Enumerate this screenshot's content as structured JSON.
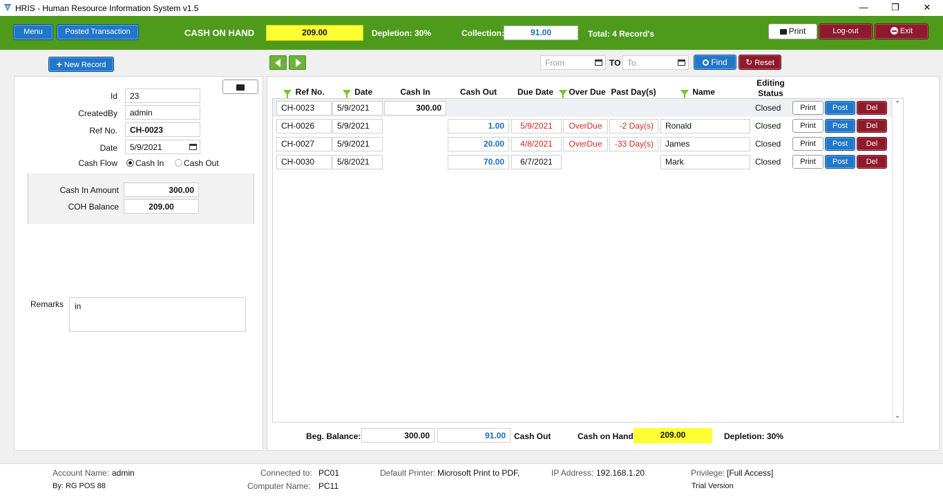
{
  "window": {
    "title": "HRIS - Human Resource Information System v1.5",
    "minimize": "—",
    "maximize": "❐",
    "close": "✕"
  },
  "toolbar": {
    "menu_label": "Menu",
    "posted_label": "Posted Transaction",
    "coh_label": "CASH ON HAND",
    "coh_value": "209.00",
    "depletion_label": "Depletion:",
    "depletion_value": "30%",
    "collection_label": "Collection:",
    "collection_value": "91.00",
    "total_text": "Total: 4 Record's",
    "print_label": "Print",
    "logout_label": "Log-out",
    "exit_label": "Exit"
  },
  "left": {
    "new_record_label": "New Record",
    "fields": {
      "id_label": "Id",
      "id_value": "23",
      "createdby_label": "CreatedBy",
      "createdby_value": "admin",
      "refno_label": "Ref No.",
      "refno_value": "CH-0023",
      "date_label": "Date",
      "date_value": "5/9/2021",
      "cashflow_label": "Cash Flow",
      "cashin_option": "Cash In",
      "cashout_option": "Cash Out",
      "cashflow_selected": "Cash In",
      "cashin_amount_label": "Cash In Amount",
      "cashin_amount_value": "300.00",
      "coh_balance_label": "COH Balance",
      "coh_balance_value": "209.00",
      "remarks_label": "Remarks",
      "remarks_value": "in"
    }
  },
  "filter": {
    "from_placeholder": "From",
    "to_label": "TO",
    "to_placeholder": "To",
    "find_label": "Find",
    "reset_label": "Reset"
  },
  "table": {
    "headers": {
      "refno": "Ref No.",
      "date": "Date",
      "cashin": "Cash In",
      "cashout": "Cash Out",
      "duedate": "Due Date",
      "overdue": "Over Due",
      "pastdays": "Past Day(s)",
      "name": "Name",
      "editing_status": "Editing Status"
    },
    "rows": [
      {
        "refno": "CH-0023",
        "date": "5/9/2021",
        "cashin": "300.00",
        "cashout": "",
        "duedate": "",
        "overdue": "",
        "pastdays": "",
        "name": "",
        "status": "Closed"
      },
      {
        "refno": "CH-0026",
        "date": "5/9/2021",
        "cashin": "",
        "cashout": "1.00",
        "duedate": "5/9/2021",
        "overdue": "OverDue",
        "pastdays": "-2 Day(s)",
        "name": "Ronald",
        "status": "Closed"
      },
      {
        "refno": "CH-0027",
        "date": "5/9/2021",
        "cashin": "",
        "cashout": "20.00",
        "duedate": "4/8/2021",
        "overdue": "OverDue",
        "pastdays": "-33 Day(s)",
        "name": "James",
        "status": "Closed"
      },
      {
        "refno": "CH-0030",
        "date": "5/8/2021",
        "cashin": "",
        "cashout": "70.00",
        "duedate": "6/7/2021",
        "overdue": "",
        "pastdays": "",
        "name": "Mark",
        "status": "Closed"
      }
    ],
    "row_print": "Print",
    "row_post": "Post",
    "row_del": "Del"
  },
  "summary": {
    "beg_label": "Beg. Balance:",
    "beg_value": "300.00",
    "cashout_value": "91.00",
    "cashout_label": "Cash Out",
    "coh_label": "Cash on Hand",
    "coh_value": "209.00",
    "depletion_text": "Depletion: 30%"
  },
  "status_bar": {
    "account_label": "Account Name:",
    "account_value": "admin",
    "by_text": "By: RG POS 88",
    "connected_label": "Connected to:",
    "connected_value": "PC01",
    "computer_label": "Computer Name:",
    "computer_value": "PC11",
    "printer_label": "Default Printer:",
    "printer_value": "Microsoft Print to PDF,",
    "ip_label": "IP Address:",
    "ip_value": "192.168.1.20",
    "privilege_label": "Privilege:",
    "privilege_value": "[Full Access]",
    "trial_text": "Trial Version"
  },
  "colors": {
    "green_bar": "#4e9b1c",
    "blue_button": "#2177c9",
    "red_button": "#8e1a2d",
    "highlight_yellow": "#ffff33",
    "value_blue": "#1a6fb5",
    "overdue_red": "#d42a1a"
  }
}
